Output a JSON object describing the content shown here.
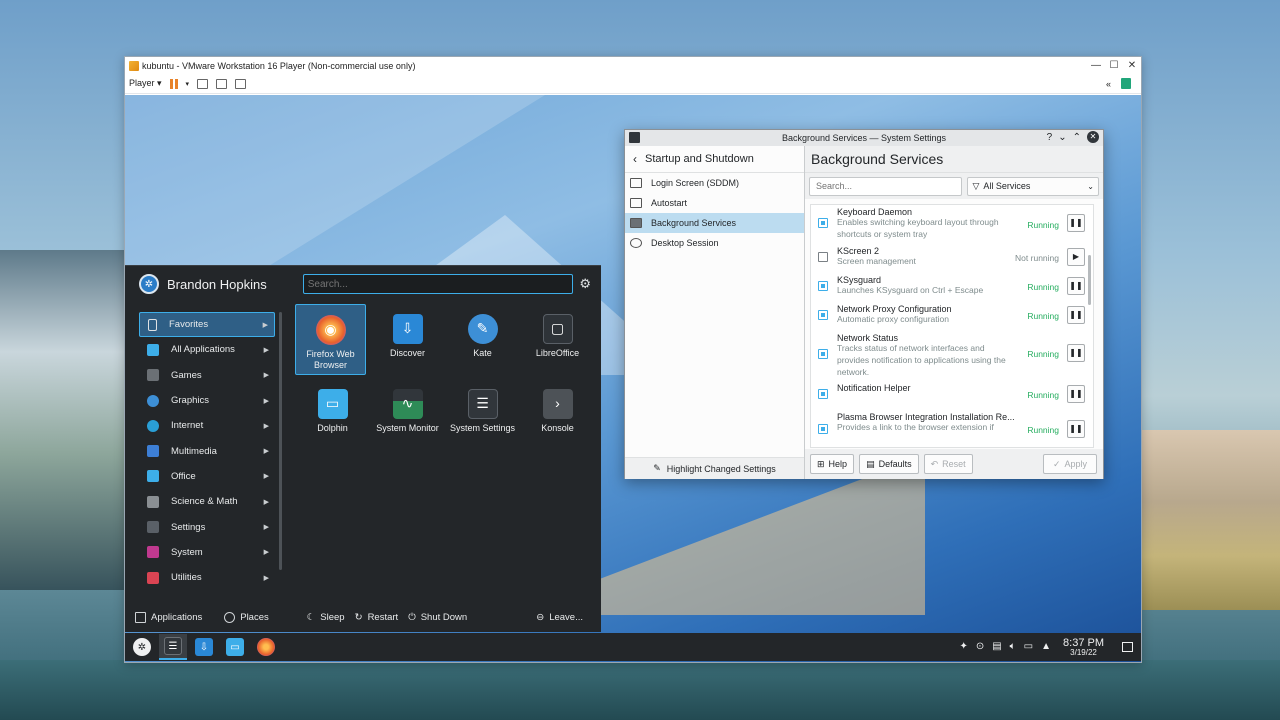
{
  "vmware": {
    "title": "kubuntu - VMware Workstation 16 Player (Non-commercial use only)",
    "player_menu": "Player ▾",
    "title_controls": [
      "—",
      "☐",
      "✕"
    ],
    "toolbar_right": "«"
  },
  "launcher": {
    "user_name": "Brandon Hopkins",
    "search_placeholder": "Search...",
    "categories": [
      {
        "label": "Favorites",
        "color": "#3a4b5c"
      },
      {
        "label": "All Applications",
        "color": "#3daee9"
      },
      {
        "label": "Games",
        "color": "#4d5257"
      },
      {
        "label": "Graphics",
        "color": "#3d8fd6"
      },
      {
        "label": "Internet",
        "color": "#2a9fd6"
      },
      {
        "label": "Multimedia",
        "color": "#3d7fd6"
      },
      {
        "label": "Office",
        "color": "#3daee9"
      },
      {
        "label": "Science & Math",
        "color": "#8a8f93"
      },
      {
        "label": "Settings",
        "color": "#5a6067"
      },
      {
        "label": "System",
        "color": "#c0398f"
      },
      {
        "label": "Utilities",
        "color": "#da4453"
      }
    ],
    "apps": [
      {
        "label": "Firefox Web Browser",
        "icon": "firefox-icon",
        "color": "#e8612c"
      },
      {
        "label": "Discover",
        "icon": "discover-icon",
        "color": "#2a88d6"
      },
      {
        "label": "Kate",
        "icon": "kate-icon",
        "color": "#3d8fd6"
      },
      {
        "label": "LibreOffice",
        "icon": "libreoffice-icon",
        "color": "#2e3338"
      },
      {
        "label": "Dolphin",
        "icon": "dolphin-folder-icon",
        "color": "#3daee9"
      },
      {
        "label": "System Monitor",
        "icon": "system-monitor-icon",
        "color": "#2e8b57"
      },
      {
        "label": "System Settings",
        "icon": "system-settings-icon",
        "color": "#31363b"
      },
      {
        "label": "Konsole",
        "icon": "konsole-icon",
        "color": "#4d5257"
      }
    ],
    "footer": {
      "applications": "Applications",
      "places": "Places",
      "sleep": "Sleep",
      "restart": "Restart",
      "shutdown": "Shut Down",
      "leave": "Leave..."
    }
  },
  "settings": {
    "window_title": "Background Services — System Settings",
    "title_controls": [
      "?",
      "⌄",
      "⌃",
      "✕"
    ],
    "back_label": "Startup and Shutdown",
    "nav_items": [
      {
        "label": "Login Screen (SDDM)"
      },
      {
        "label": "Autostart"
      },
      {
        "label": "Background Services"
      },
      {
        "label": "Desktop Session"
      }
    ],
    "highlight_label": "Highlight Changed Settings",
    "page_title": "Background Services",
    "search_placeholder": "Search...",
    "filter_value": "All Services",
    "services": [
      {
        "name": "Keyboard Daemon",
        "desc": "Enables switching keyboard layout through shortcuts or system tray",
        "state": "Running",
        "enabled": true
      },
      {
        "name": "KScreen 2",
        "desc": "Screen management",
        "state": "Not running",
        "enabled": false
      },
      {
        "name": "KSysguard",
        "desc": "Launches KSysguard on Ctrl + Escape",
        "state": "Running",
        "enabled": true
      },
      {
        "name": "Network Proxy Configuration",
        "desc": "Automatic proxy configuration",
        "state": "Running",
        "enabled": true
      },
      {
        "name": "Network Status",
        "desc": "Tracks status of network interfaces and provides notification to applications using the network.",
        "state": "Running",
        "enabled": true
      },
      {
        "name": "Notification Helper",
        "desc": "",
        "state": "Running",
        "enabled": true
      },
      {
        "name": "Plasma Browser Integration Installation Re...",
        "desc": "Provides a link to the browser extension if",
        "state": "Running",
        "enabled": true
      }
    ],
    "buttons": {
      "help": "Help",
      "defaults": "Defaults",
      "reset": "Reset",
      "apply": "Apply"
    }
  },
  "panel": {
    "time": "8:37 PM",
    "date": "3/19/22",
    "tray_icons": [
      "kde-connect-icon",
      "updates-icon",
      "clipboard-icon",
      "volume-icon",
      "network-icon",
      "tray-expand-icon"
    ]
  }
}
